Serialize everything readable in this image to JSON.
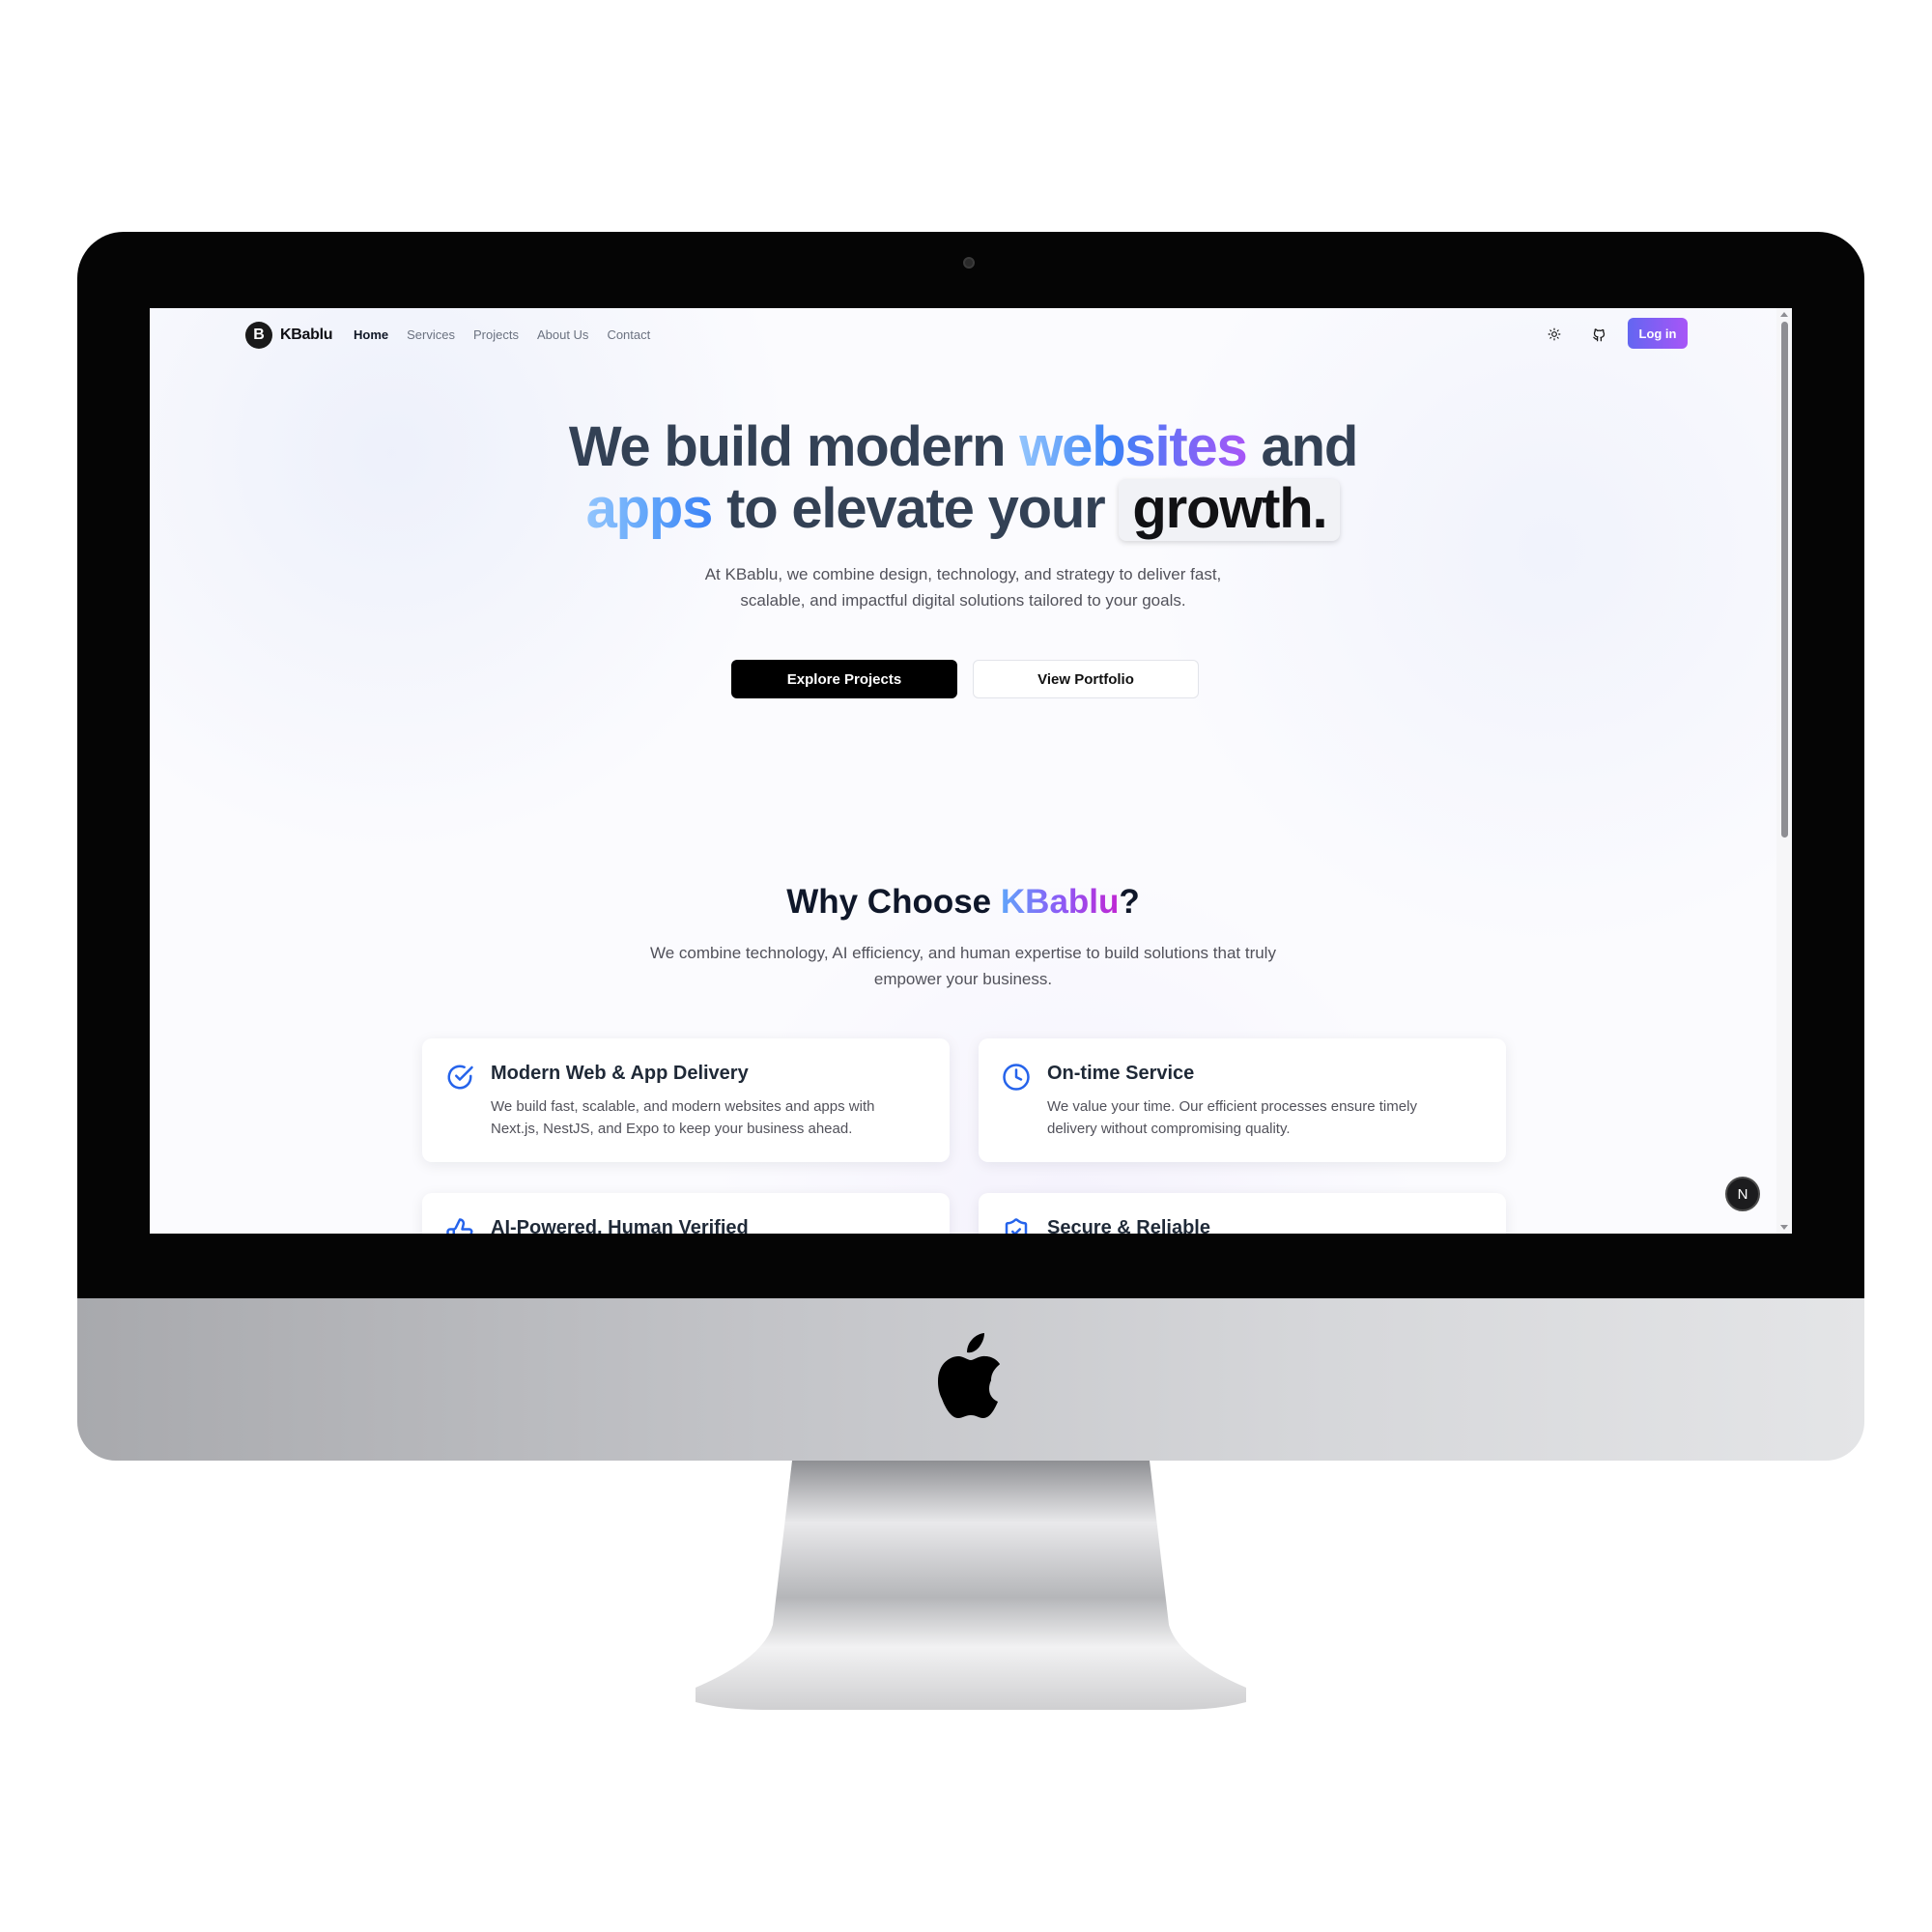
{
  "nav": {
    "brand": "KBablu",
    "logo_letter": "B",
    "links": [
      {
        "label": "Home",
        "active": true
      },
      {
        "label": "Services",
        "active": false
      },
      {
        "label": "Projects",
        "active": false
      },
      {
        "label": "About Us",
        "active": false
      },
      {
        "label": "Contact",
        "active": false
      }
    ],
    "theme_icon": "sun-icon",
    "github_icon": "github-icon",
    "login_label": "Log in"
  },
  "hero": {
    "title_part1": "We build modern ",
    "title_highlight1": "websites",
    "title_part2": " and",
    "title_highlight2": "apps",
    "title_part3": " to elevate your ",
    "title_boxed": "growth.",
    "subtitle": "At KBablu, we combine design, technology, and strategy to deliver fast, scalable, and impactful digital solutions tailored to your goals.",
    "primary_cta": "Explore Projects",
    "secondary_cta": "View Portfolio"
  },
  "why": {
    "title_prefix": "Why Choose ",
    "title_brand": "KBablu",
    "title_suffix": "?",
    "subtitle": "We combine technology, AI efficiency, and human expertise to build solutions that truly empower your business.",
    "cards": [
      {
        "icon": "check-circle-icon",
        "title": "Modern Web & App Delivery",
        "desc": "We build fast, scalable, and modern websites and apps with Next.js, NestJS, and Expo to keep your business ahead."
      },
      {
        "icon": "clock-icon",
        "title": "On-time Service",
        "desc": "We value your time. Our efficient processes ensure timely delivery without compromising quality."
      },
      {
        "icon": "thumbs-up-icon",
        "title": "AI-Powered, Human Verified",
        "desc": ""
      },
      {
        "icon": "shield-check-icon",
        "title": "Secure & Reliable",
        "desc": ""
      }
    ]
  },
  "floating_badge": "N",
  "colors": {
    "accent_gradient_start": "#6366f1",
    "accent_gradient_end": "#a855f7",
    "icon_blue": "#2563eb",
    "heading": "#334155"
  }
}
